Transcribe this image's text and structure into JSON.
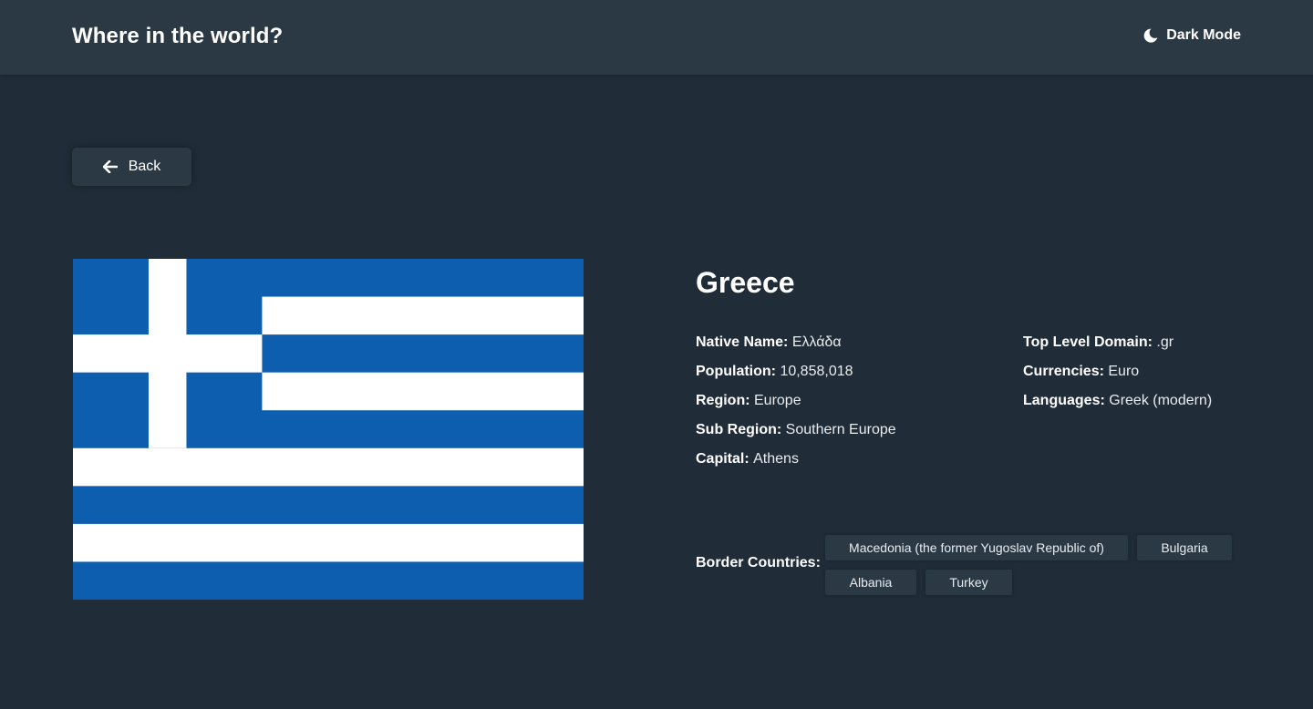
{
  "header": {
    "title": "Where in the world?",
    "theme_toggle_label": "Dark Mode",
    "theme_icon": "moon-icon"
  },
  "back_button": {
    "label": "Back",
    "icon": "arrow-left-icon"
  },
  "country": {
    "name": "Greece",
    "flag_colors": {
      "blue": "#0d5eaf",
      "white": "#ffffff"
    },
    "details_left": [
      {
        "label": "Native Name:",
        "value": "Ελλάδα"
      },
      {
        "label": "Population:",
        "value": "10,858,018"
      },
      {
        "label": "Region:",
        "value": "Europe"
      },
      {
        "label": "Sub Region:",
        "value": "Southern Europe"
      },
      {
        "label": "Capital:",
        "value": "Athens"
      }
    ],
    "details_right": [
      {
        "label": "Top Level Domain:",
        "value": ".gr"
      },
      {
        "label": "Currencies:",
        "value": "Euro"
      },
      {
        "label": "Languages:",
        "value": "Greek (modern)"
      }
    ],
    "border_label": "Border Countries:",
    "border_countries": [
      "Macedonia (the former Yugoslav Republic of)",
      "Bulgaria",
      "Albania",
      "Turkey"
    ]
  },
  "colors": {
    "background": "#202c37",
    "element": "#2b3945",
    "text": "#ffffff"
  }
}
